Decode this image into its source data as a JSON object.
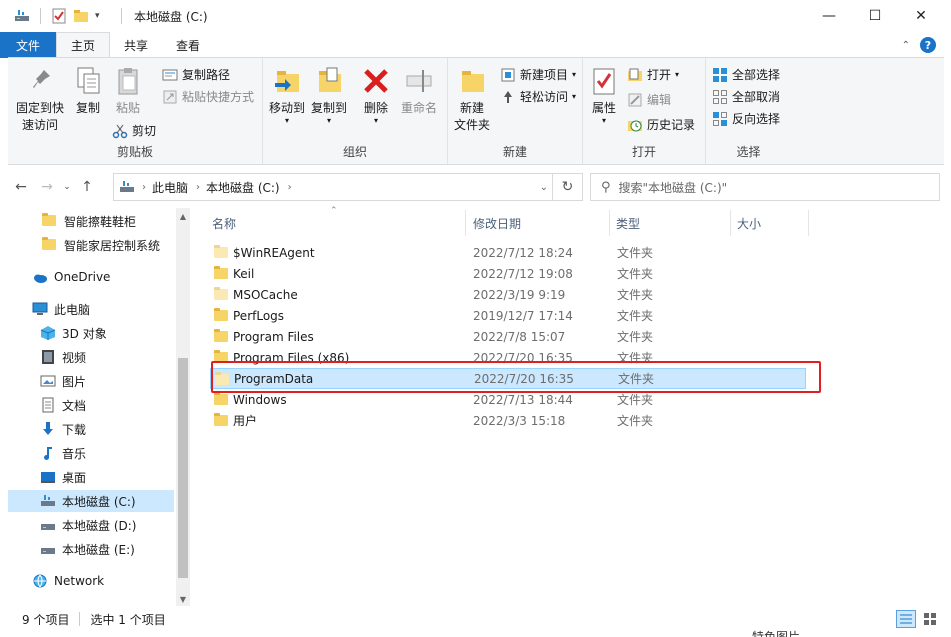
{
  "window": {
    "title": "本地磁盘 (C:)",
    "minimize": "—",
    "maximize": "☐",
    "close": "✕"
  },
  "tabs": [
    {
      "label": "文件"
    },
    {
      "label": "主页"
    },
    {
      "label": "共享"
    },
    {
      "label": "查看"
    }
  ],
  "ribbon": {
    "clipboard": {
      "label": "剪贴板",
      "pin_line1": "固定到快",
      "pin_line2": "速访问",
      "copy": "复制",
      "paste": "粘贴",
      "copy_path": "复制路径",
      "paste_shortcut": "粘贴快捷方式",
      "cut": "剪切"
    },
    "organize": {
      "label": "组织",
      "move_to": "移动到",
      "copy_to": "复制到",
      "delete": "删除",
      "rename": "重命名"
    },
    "new": {
      "label": "新建",
      "new_folder_line1": "新建",
      "new_folder_line2": "文件夹",
      "new_item": "新建项目",
      "easy_access": "轻松访问"
    },
    "open": {
      "label": "打开",
      "properties": "属性",
      "open": "打开",
      "edit": "编辑",
      "history": "历史记录"
    },
    "select": {
      "label": "选择",
      "select_all": "全部选择",
      "select_none": "全部取消",
      "invert": "反向选择"
    }
  },
  "address": {
    "crumb1": "此电脑",
    "crumb2": "本地磁盘 (C:)",
    "search_placeholder": "搜索\"本地磁盘 (C:)\""
  },
  "nav": [
    {
      "label": "智能擦鞋鞋柜",
      "icon": "folder-icon"
    },
    {
      "label": "智能家居控制系统",
      "icon": "folder-icon"
    },
    {
      "label": "OneDrive",
      "icon": "cloud-icon"
    },
    {
      "label": "此电脑",
      "icon": "computer-icon"
    },
    {
      "label": "3D 对象",
      "icon": "cube-icon"
    },
    {
      "label": "视频",
      "icon": "video-icon"
    },
    {
      "label": "图片",
      "icon": "picture-icon"
    },
    {
      "label": "文档",
      "icon": "document-icon"
    },
    {
      "label": "下载",
      "icon": "download-icon"
    },
    {
      "label": "音乐",
      "icon": "music-icon"
    },
    {
      "label": "桌面",
      "icon": "desktop-icon"
    },
    {
      "label": "本地磁盘 (C:)",
      "icon": "drive-icon"
    },
    {
      "label": "本地磁盘 (D:)",
      "icon": "drive-icon"
    },
    {
      "label": "本地磁盘 (E:)",
      "icon": "drive-icon"
    },
    {
      "label": "Network",
      "icon": "network-icon"
    }
  ],
  "columns": {
    "name": "名称",
    "date": "修改日期",
    "type": "类型",
    "size": "大小"
  },
  "files": [
    {
      "name": "$WinREAgent",
      "date": "2022/7/12 18:24",
      "type": "文件夹"
    },
    {
      "name": "Keil",
      "date": "2022/7/12 19:08",
      "type": "文件夹"
    },
    {
      "name": "MSOCache",
      "date": "2022/3/19 9:19",
      "type": "文件夹"
    },
    {
      "name": "PerfLogs",
      "date": "2019/12/7 17:14",
      "type": "文件夹"
    },
    {
      "name": "Program Files",
      "date": "2022/7/8 15:07",
      "type": "文件夹"
    },
    {
      "name": "Program Files (x86)",
      "date": "2022/7/20 16:35",
      "type": "文件夹"
    },
    {
      "name": "ProgramData",
      "date": "2022/7/20 16:35",
      "type": "文件夹"
    },
    {
      "name": "Windows",
      "date": "2022/7/13 18:44",
      "type": "文件夹"
    },
    {
      "name": "用户",
      "date": "2022/3/3 15:18",
      "type": "文件夹"
    }
  ],
  "status": {
    "count": "9 个项目",
    "selected": "选中 1 个项目"
  },
  "footer_fragment": "特色图片",
  "colors": {
    "accent": "#1a73c7",
    "selection": "#cce8ff",
    "highlight_box": "#e02020",
    "folder": "#f7d468"
  }
}
